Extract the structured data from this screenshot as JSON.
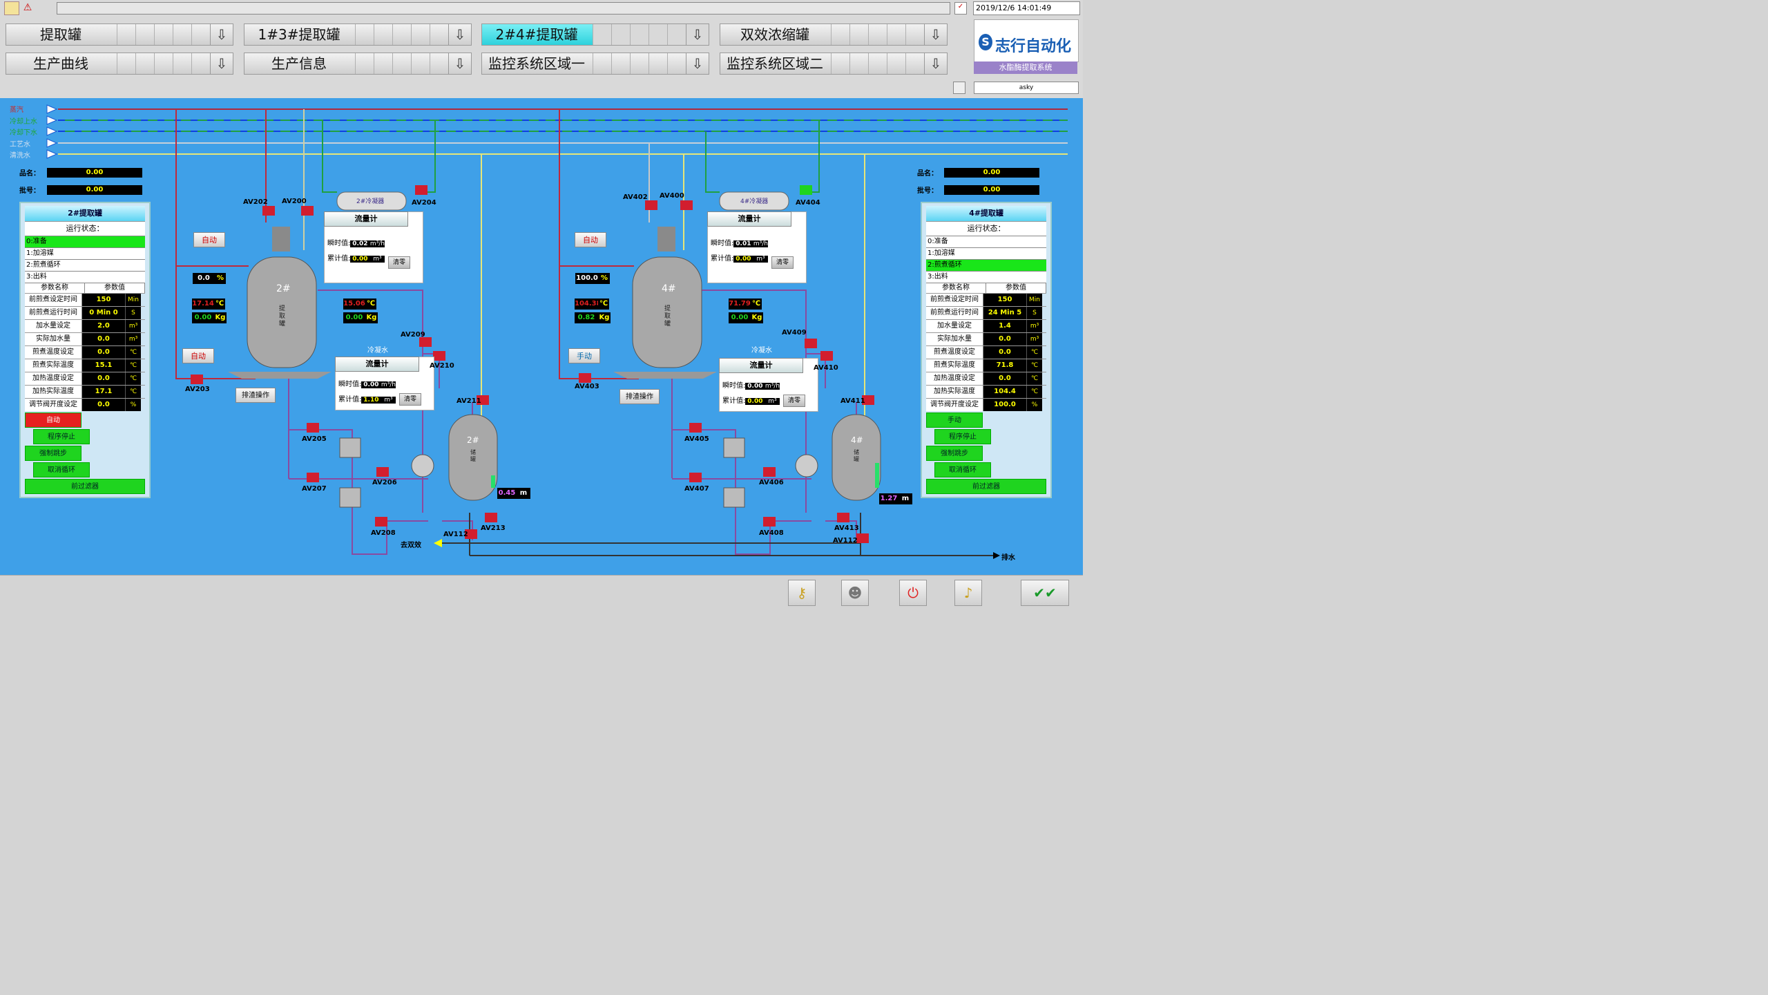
{
  "header": {
    "datetime": "2019/12/6 14:01:49",
    "user": "asky",
    "logo_text": "志行自动化",
    "system_name": "水酯酶提取系统",
    "nav_row1": [
      "提取罐",
      "1#3#提取罐",
      "2#4#提取罐",
      "双效浓缩罐"
    ],
    "nav_row2": [
      "生产曲线",
      "生产信息",
      "监控系统区域一",
      "监控系统区域二"
    ],
    "active_nav": "2#4#提取罐"
  },
  "pipes": [
    "蒸汽",
    "冷却上水",
    "冷却下水",
    "工艺水",
    "清洗水"
  ],
  "left": {
    "product_label": "品名：",
    "product_value": "0.00",
    "batch_label": "批号：",
    "batch_value": "0.00",
    "panel_title": "2#提取罐",
    "status_label": "运行状态：",
    "states": [
      "0:准备",
      "1:加溶媒",
      "2:煎煮循环",
      "3:出料"
    ],
    "active_state": 0,
    "param_header": [
      "参数名称",
      "参数值"
    ],
    "params": [
      {
        "n": "前煎煮设定时间",
        "v": "150",
        "u": "Min"
      },
      {
        "n": "前煎煮运行时间",
        "v": "0  Min 0",
        "u": "S"
      },
      {
        "n": "加水量设定",
        "v": "2.0",
        "u": "m³"
      },
      {
        "n": "实际加水量",
        "v": "0.0",
        "u": "m³"
      },
      {
        "n": "煎煮温度设定",
        "v": "0.0",
        "u": "℃"
      },
      {
        "n": "煎煮实际温度",
        "v": "15.1",
        "u": "℃"
      },
      {
        "n": "加热温度设定",
        "v": "0.0",
        "u": "℃"
      },
      {
        "n": "加热实际温度",
        "v": "17.1",
        "u": "℃"
      },
      {
        "n": "调节阀开度设定",
        "v": "0.0",
        "u": "%"
      }
    ],
    "btn_mode": "自动",
    "btn_stop": "程序停止",
    "btn_skip": "强制跳步",
    "btn_cancel": "取消循环",
    "btn_filter": "前过滤器"
  },
  "right": {
    "product_label": "品名：",
    "product_value": "0.00",
    "batch_label": "批号：",
    "batch_value": "0.00",
    "panel_title": "4#提取罐",
    "status_label": "运行状态：",
    "states": [
      "0:准备",
      "1:加溶媒",
      "2:煎煮循环",
      "3:出料"
    ],
    "active_state": 2,
    "param_header": [
      "参数名称",
      "参数值"
    ],
    "params": [
      {
        "n": "前煎煮设定时间",
        "v": "150",
        "u": "Min"
      },
      {
        "n": "前煎煮运行时间",
        "v": "24  Min 5",
        "u": "S"
      },
      {
        "n": "加水量设定",
        "v": "1.4",
        "u": "m³"
      },
      {
        "n": "实际加水量",
        "v": "0.0",
        "u": "m³"
      },
      {
        "n": "煎煮温度设定",
        "v": "0.0",
        "u": "℃"
      },
      {
        "n": "煎煮实际温度",
        "v": "71.8",
        "u": "℃"
      },
      {
        "n": "加热温度设定",
        "v": "0.0",
        "u": "℃"
      },
      {
        "n": "加热实际温度",
        "v": "104.4",
        "u": "℃"
      },
      {
        "n": "调节阀开度设定",
        "v": "100.0",
        "u": "%"
      }
    ],
    "btn_mode": "手动",
    "btn_stop": "程序停止",
    "btn_skip": "强制跳步",
    "btn_cancel": "取消循环",
    "btn_filter": "前过滤器"
  },
  "unit2": {
    "condenser": "2#冷凝器",
    "tank": "2#",
    "tank_sub": "提取罐",
    "storage": "2#",
    "storage_sub": "储罐",
    "auto_top": "自动",
    "auto_bottom": "自动",
    "valve_open": "0.0",
    "pct": "%",
    "temp_l": "17.14",
    "kg_l": "0.00",
    "temp_r": "15.06",
    "kg_r": "0.00",
    "c": "℃",
    "kg": "Kg",
    "flow1": {
      "title": "流量计",
      "inst_label": "瞬时值:",
      "inst": "0.02",
      "inst_u": "m³/h",
      "acc_label": "累计值:",
      "acc": "0.00",
      "acc_u": "m³",
      "clear": "清零"
    },
    "flow2": {
      "title": "流量计",
      "inst_label": "瞬时值:",
      "inst": "0.00",
      "inst_u": "m³/h",
      "acc_label": "累计值:",
      "acc": "1.10",
      "acc_u": "m³",
      "clear": "清零"
    },
    "drain_btn": "排渣操作",
    "cond_water": "冷凝水",
    "level": "0.45",
    "level_u": "m",
    "valves": [
      "AV202",
      "AV200",
      "AV204",
      "AV203",
      "AV209",
      "AV210",
      "AV211",
      "AV205",
      "AV206",
      "AV207",
      "AV208",
      "AV213",
      "AV112"
    ]
  },
  "unit4": {
    "condenser": "4#冷凝器",
    "tank": "4#",
    "tank_sub": "提取罐",
    "storage": "4#",
    "storage_sub": "储罐",
    "auto_top": "自动",
    "auto_bottom": "手动",
    "valve_open": "100.0",
    "pct": "%",
    "temp_l": "104.38",
    "kg_l": "0.82",
    "temp_r": "71.79",
    "kg_r": "0.00",
    "c": "℃",
    "kg": "Kg",
    "flow1": {
      "title": "流量计",
      "inst_label": "瞬时值:",
      "inst": "0.01",
      "inst_u": "m³/h",
      "acc_label": "累计值:",
      "acc": "0.00",
      "acc_u": "m³",
      "clear": "清零"
    },
    "flow2": {
      "title": "流量计",
      "inst_label": "瞬时值:",
      "inst": "0.00",
      "inst_u": "m³/h",
      "acc_label": "累计值:",
      "acc": "0.00",
      "acc_u": "m³",
      "clear": "清零"
    },
    "drain_btn": "排渣操作",
    "cond_water": "冷凝水",
    "level": "1.27",
    "level_u": "m",
    "valves": [
      "AV402",
      "AV400",
      "AV404",
      "AV403",
      "AV409",
      "AV410",
      "AV411",
      "AV405",
      "AV406",
      "AV407",
      "AV408",
      "AV413",
      "AV112"
    ]
  },
  "to_double": "去双效",
  "drain_out": "排水",
  "colors": {
    "bg": "#3fa0e8",
    "steam": "#c0282e",
    "cool": "#1ea832",
    "process": "#e0e070",
    "pipe_purple": "#7a4a9a"
  }
}
